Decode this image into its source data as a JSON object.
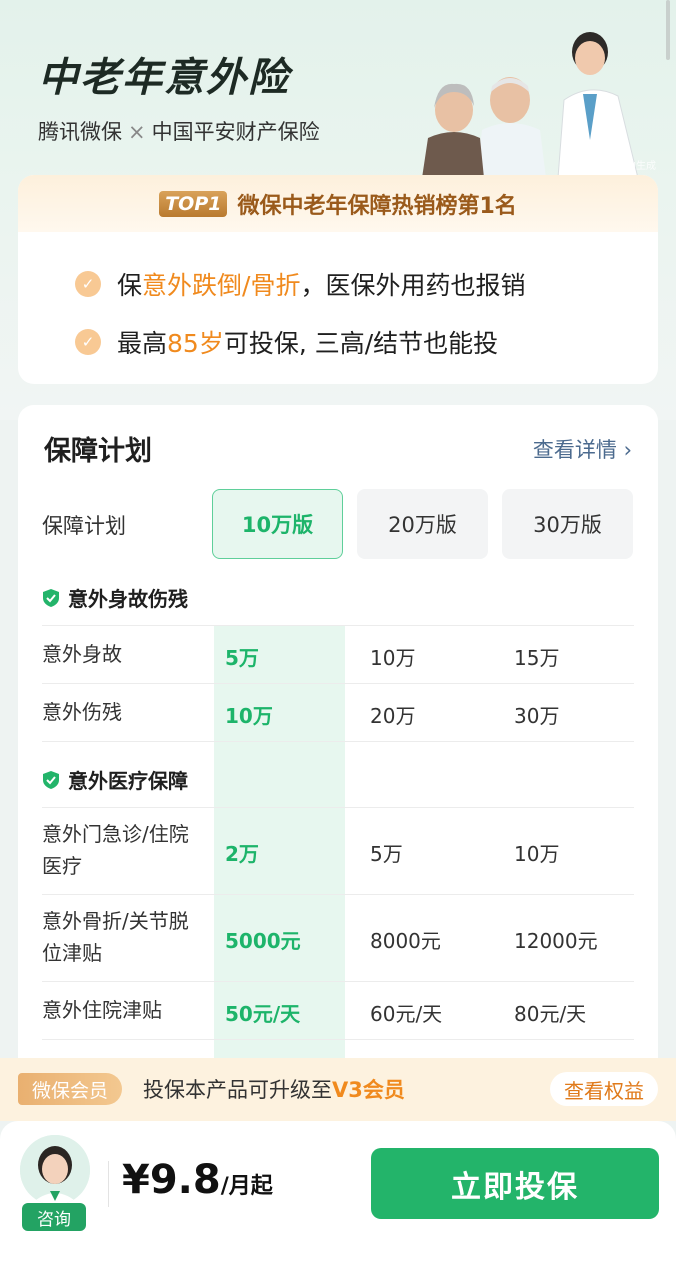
{
  "hero": {
    "title": "中老年意外险",
    "partner_a": "腾讯微保",
    "partner_sep": "×",
    "partner_b": "中国平安财产保险",
    "image_note": "本图片由AI生成"
  },
  "promo": {
    "rank_badge": "TOP1",
    "rank_text": "微保中老年保障热销榜第1名",
    "features": [
      {
        "pre": "保",
        "hl": "意外跌倒/骨折",
        "post": "，医保外用药也报销"
      },
      {
        "pre": "最高",
        "hl": "85岁",
        "post": "可投保, 三高/结节也能投"
      }
    ]
  },
  "plan": {
    "title": "保障计划",
    "detail_link": "查看详情",
    "label": "保障计划",
    "options": [
      "10万版",
      "20万版",
      "30万版"
    ],
    "selected_index": 0,
    "sections": [
      {
        "name": "意外身故伤残",
        "rows": [
          {
            "name": "意外身故",
            "values": [
              "5万",
              "10万",
              "15万"
            ]
          },
          {
            "name": "意外伤残",
            "values": [
              "10万",
              "20万",
              "30万"
            ]
          }
        ]
      },
      {
        "name": "意外医疗保障",
        "rows": [
          {
            "name": "意外门急诊/住院医疗",
            "values": [
              "2万",
              "5万",
              "10万"
            ]
          },
          {
            "name": "意外骨折/关节脱位津贴",
            "values": [
              "5000元",
              "8000元",
              "12000元"
            ]
          },
          {
            "name": "意外住院津贴",
            "values": [
              "50元/天",
              "60元/天",
              "80元/天"
            ]
          }
        ]
      }
    ]
  },
  "member": {
    "badge": "微保会员",
    "text_pre": "投保本产品可升级至",
    "text_hl": "V3会员",
    "button": "查看权益"
  },
  "bottom": {
    "consult": "咨询",
    "price": "¥9.8",
    "price_unit": "/月起",
    "buy": "立即投保"
  },
  "colors": {
    "accent_green": "#23b46a",
    "highlight_orange": "#f08a1e",
    "link_blue": "#4b6a8e"
  }
}
